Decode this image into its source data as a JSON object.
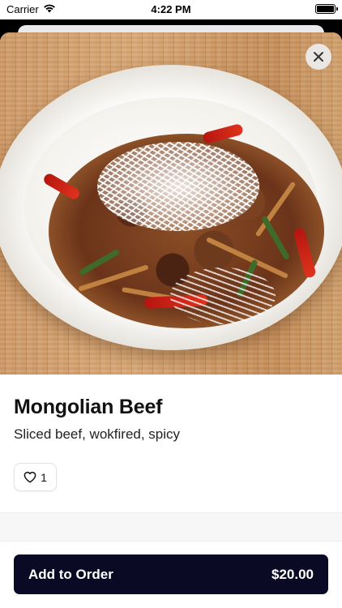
{
  "status_bar": {
    "carrier": "Carrier",
    "time": "4:22 PM",
    "wifi_icon": "wifi-icon",
    "battery_icon": "battery-icon"
  },
  "item": {
    "name": "Mongolian Beef",
    "description": "Sliced beef, wokfired, spicy",
    "likes": "1",
    "like_icon": "heart-icon"
  },
  "actions": {
    "close_icon": "close-icon",
    "add_to_order_label": "Add to Order",
    "price": "$20.00"
  },
  "colors": {
    "primary_button": "#0b0a24",
    "close_button_bg": "#ebebeb"
  }
}
